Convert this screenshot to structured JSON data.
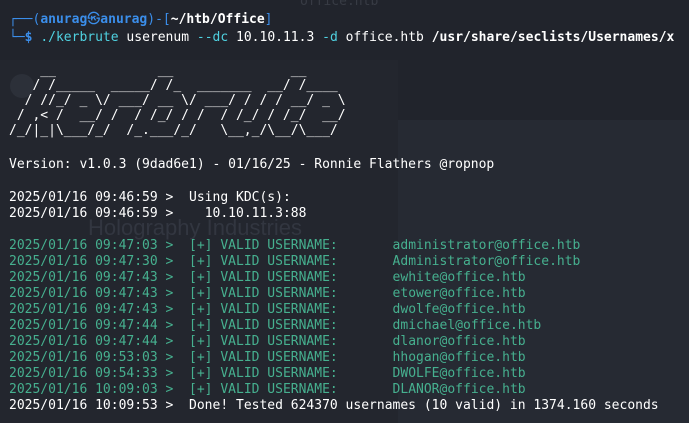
{
  "terminal": {
    "bg_title": "office.htb",
    "prompt": {
      "box_top": "┌──(",
      "user": "anurag",
      "at": "㉿",
      "host": "anurag",
      "mid": ")-[",
      "path": "~/htb/Office",
      "end": "]",
      "box_bottom": "└─",
      "symbol": "$"
    },
    "command": {
      "program": "./kerbrute",
      "sub": "userenum",
      "flag_dc": "--dc",
      "dc_value": "10.10.11.3",
      "flag_d": "-d",
      "domain_value": "office.htb",
      "wordlist": "/usr/share/seclists/Usernames/x"
    },
    "banner": [
      "    __             __               __     ",
      "   / /_____  _____/ /_  _______  __/ /____ ",
      "  / //_/ _ \\/ ___/ __ \\/ ___/ / / / __/ _ \\",
      " / ,< /  __/ /  / /_/ / /  / /_/ / /_/  __/",
      "/_/|_|\\___/_/  /_.___/_/   \\__,_/\\__/\\___/ "
    ],
    "version": "Version: v1.0.3 (9dad6e1) - 01/16/25 - Ronnie Flathers @ropnop",
    "kdc_lines": [
      {
        "ts": "2025/01/16 09:46:59 >",
        "msg": "  Using KDC(s):"
      },
      {
        "ts": "2025/01/16 09:46:59 >",
        "msg": "  \t10.10.11.3:88"
      }
    ],
    "results": [
      {
        "ts": "2025/01/16 09:47:03 >",
        "label": "[+] VALID USERNAME:",
        "user": "administrator@office.htb"
      },
      {
        "ts": "2025/01/16 09:47:30 >",
        "label": "[+] VALID USERNAME:",
        "user": "Administrator@office.htb"
      },
      {
        "ts": "2025/01/16 09:47:43 >",
        "label": "[+] VALID USERNAME:",
        "user": "ewhite@office.htb"
      },
      {
        "ts": "2025/01/16 09:47:43 >",
        "label": "[+] VALID USERNAME:",
        "user": "etower@office.htb"
      },
      {
        "ts": "2025/01/16 09:47:43 >",
        "label": "[+] VALID USERNAME:",
        "user": "dwolfe@office.htb"
      },
      {
        "ts": "2025/01/16 09:47:44 >",
        "label": "[+] VALID USERNAME:",
        "user": "dmichael@office.htb"
      },
      {
        "ts": "2025/01/16 09:47:44 >",
        "label": "[+] VALID USERNAME:",
        "user": "dlanor@office.htb"
      },
      {
        "ts": "2025/01/16 09:53:03 >",
        "label": "[+] VALID USERNAME:",
        "user": "hhogan@office.htb"
      },
      {
        "ts": "2025/01/16 09:54:33 >",
        "label": "[+] VALID USERNAME:",
        "user": "DWOLFE@office.htb"
      },
      {
        "ts": "2025/01/16 10:09:03 >",
        "label": "[+] VALID USERNAME:",
        "user": "DLANOR@office.htb"
      }
    ],
    "done": {
      "ts": "2025/01/16 10:09:53 >",
      "msg": "  Done! Tested 624370 usernames (10 valid) in 1374.160 seconds"
    },
    "bg_company": "Holography Industries",
    "colors": {
      "prompt_blue": "#3b8eea",
      "cmd_cyan": "#4fd1e0",
      "result_green": "#46b08f",
      "background": "#21242c"
    }
  }
}
